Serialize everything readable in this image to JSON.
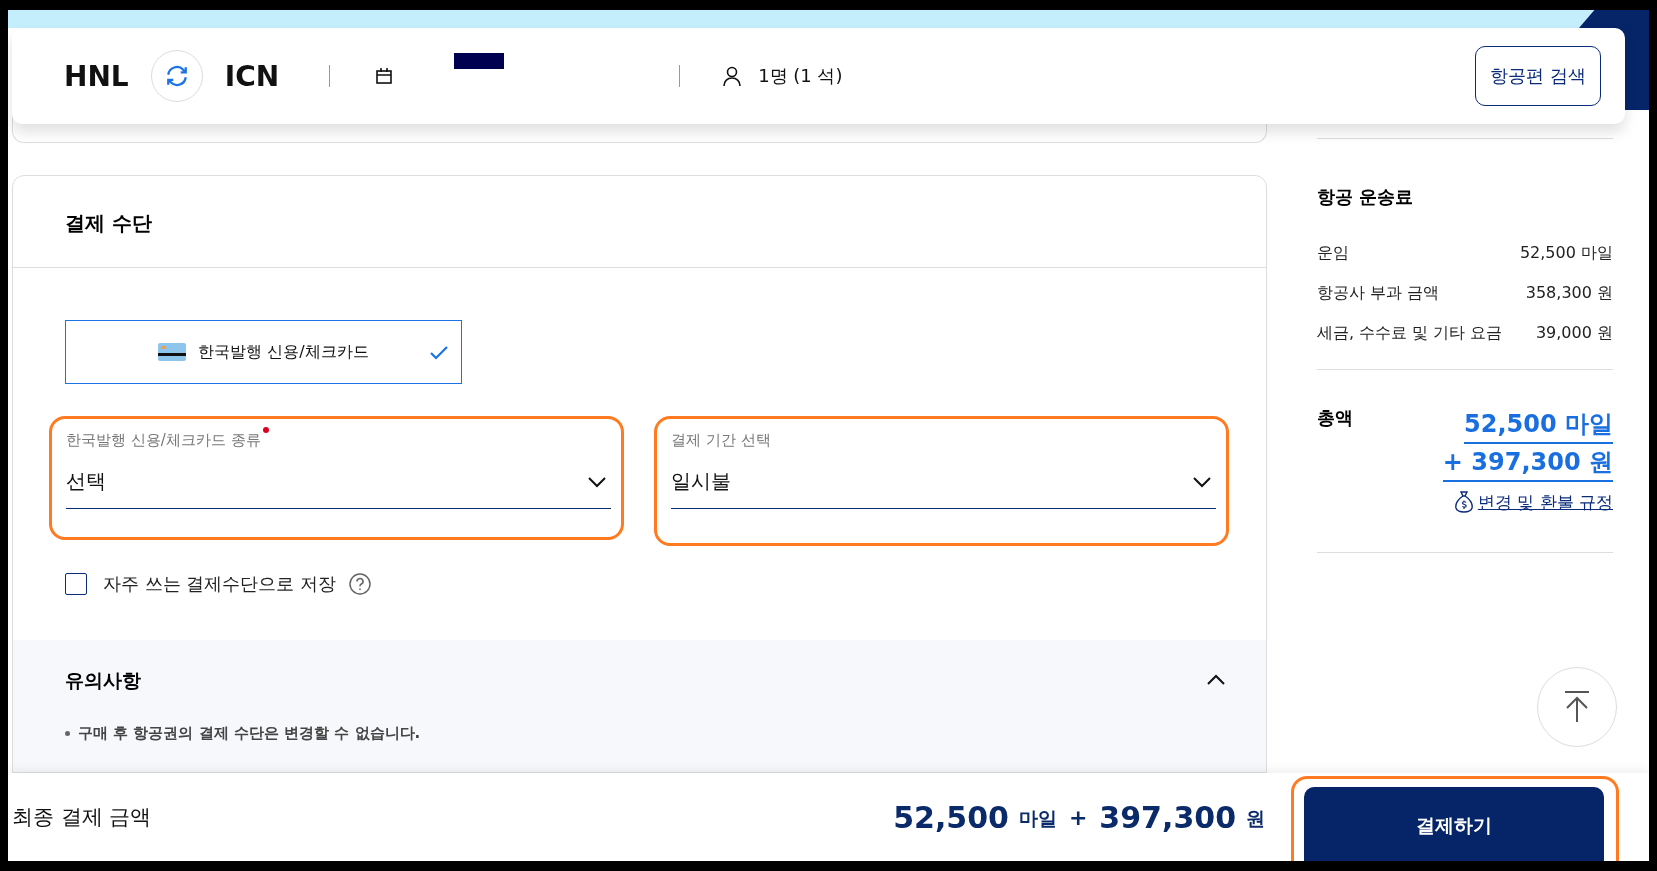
{
  "search_bar": {
    "origin": "HNL",
    "destination": "ICN",
    "date_redacted": true,
    "passengers": "1명 (1 석)",
    "search_button": "항공편 검색"
  },
  "payment": {
    "title": "결제 수단",
    "method": {
      "label": "한국발행 신용/체크카드",
      "selected": true
    },
    "selects": [
      {
        "label": "한국발행 신용/체크카드 종류",
        "required": true,
        "value": "선택",
        "highlighted": true
      },
      {
        "label": "결제 기간 선택",
        "required": false,
        "value": "일시불",
        "highlighted": true
      }
    ],
    "save_option": {
      "label": "자주 쓰는 결제수단으로 저장",
      "checked": false
    },
    "notes": {
      "title": "유의사항",
      "expanded": true,
      "items": [
        "구매 후 항공권의 결제 수단은 변경할 수 없습니다."
      ]
    }
  },
  "summary": {
    "title": "항공 운송료",
    "rows": [
      {
        "label": "운임",
        "value": "52,500 마일"
      },
      {
        "label": "항공사 부과 금액",
        "value": "358,300 원"
      },
      {
        "label": "세금, 수수료 및 기타 요금",
        "value": "39,000 원"
      }
    ],
    "total_label": "총액",
    "total_miles": "52,500 마일",
    "total_won": "+ 397,300 원",
    "refund_link": "변경 및 환불 규정"
  },
  "footer": {
    "label": "최종 결제 금액",
    "miles": "52,500",
    "miles_unit": "마일",
    "plus": "+",
    "won": "397,300",
    "won_unit": "원",
    "pay_button": "결제하기",
    "pay_highlighted": true
  }
}
